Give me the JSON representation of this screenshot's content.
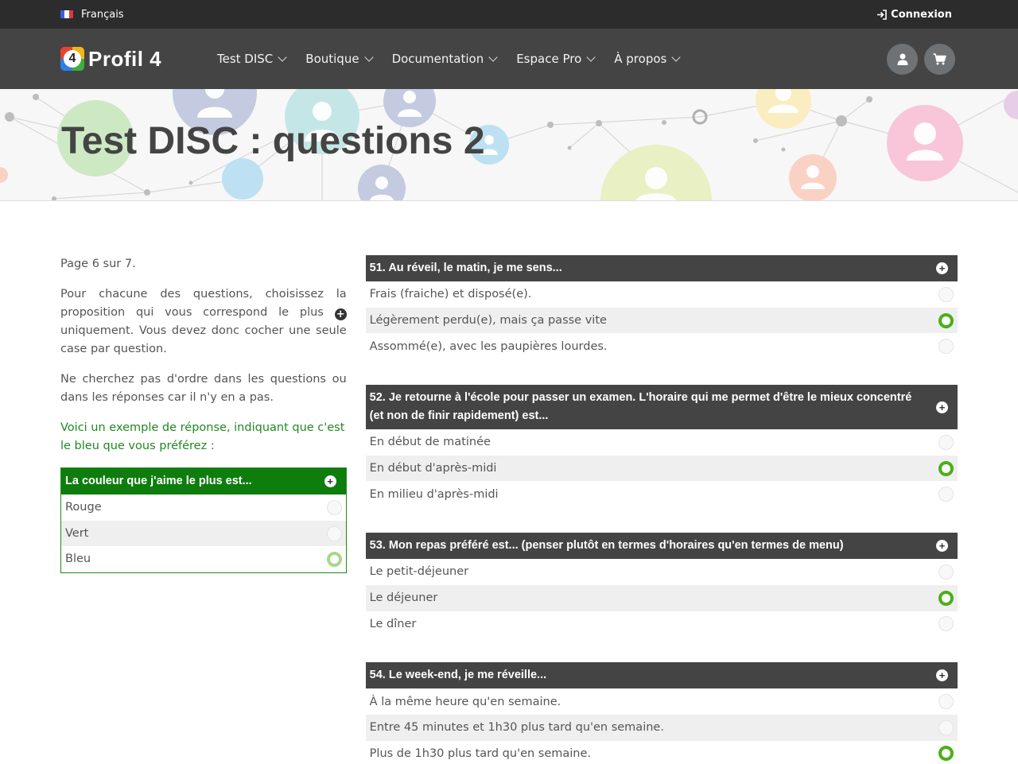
{
  "topbar": {
    "language": "Français",
    "login": "Connexion"
  },
  "brand": {
    "name": "Profil 4",
    "mark": "4"
  },
  "nav": [
    {
      "label": "Test DISC"
    },
    {
      "label": "Boutique"
    },
    {
      "label": "Documentation"
    },
    {
      "label": "Espace Pro"
    },
    {
      "label": "À propos"
    }
  ],
  "page": {
    "title": "Test DISC : questions 2"
  },
  "intro": {
    "page_info": "Page 6 sur 7.",
    "para1_a": "Pour chacune des questions, choisissez la proposition qui vous correspond le plus",
    "para1_b": "uniquement. Vous devez donc cocher une seule case par question.",
    "para2": "Ne cherchez pas d'ordre dans les questions ou dans les réponses car il n'y en a pas.",
    "example_text": "Voici un exemple de réponse, indiquant que c'est le bleu que vous préférez :"
  },
  "example": {
    "question": "La couleur que j'aime le plus est...",
    "options": [
      "Rouge",
      "Vert",
      "Bleu"
    ],
    "selected": 2
  },
  "questions": [
    {
      "title": "51. Au réveil, le matin, je me sens...",
      "options": [
        "Frais (fraiche) et disposé(e).",
        "Légèrement perdu(e), mais ça passe vite",
        "Assommé(e), avec les paupières lourdes."
      ],
      "selected": 1
    },
    {
      "title": "52. Je retourne à l'école pour passer un examen. L'horaire qui me permet d'être le mieux concentré (et non de finir rapidement) est...",
      "options": [
        "En début de matinée",
        "En début d'après-midi",
        "En milieu d'après-midi"
      ],
      "selected": 1
    },
    {
      "title": "53. Mon repas préféré est... (penser plutôt en termes d'horaires qu'en termes de menu)",
      "options": [
        "Le petit-déjeuner",
        "Le déjeuner",
        "Le dîner"
      ],
      "selected": 1
    },
    {
      "title": "54. Le week-end, je me réveille...",
      "options": [
        "À la même heure qu'en semaine.",
        "Entre 45 minutes et 1h30 plus tard qu'en semaine.",
        "Plus de 1h30 plus tard qu'en semaine."
      ],
      "selected": 2
    }
  ]
}
